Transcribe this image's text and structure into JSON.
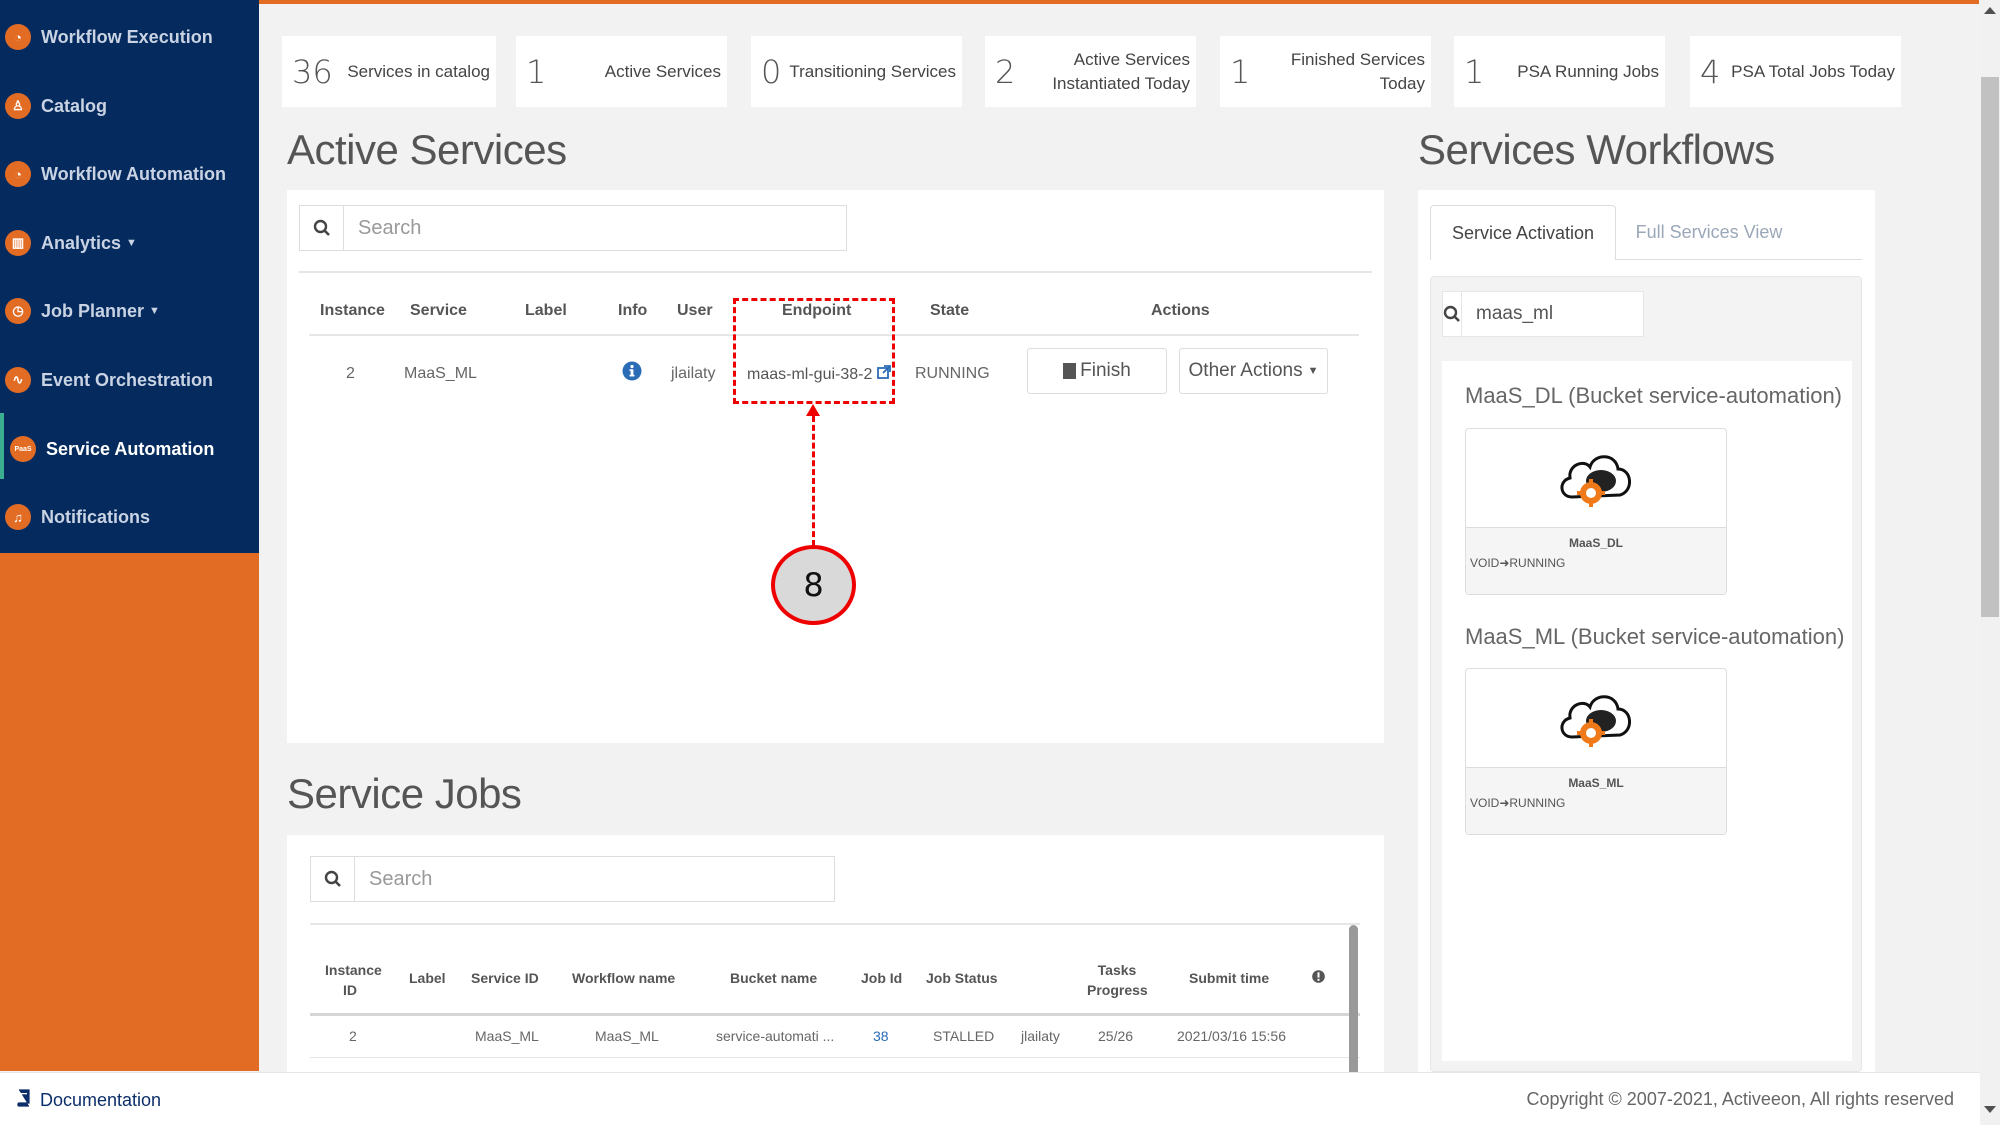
{
  "sidebar": {
    "items": [
      {
        "label": "Workflow Execution",
        "icon": "gauge-icon"
      },
      {
        "label": "Catalog",
        "icon": "catalog-icon"
      },
      {
        "label": "Workflow Automation",
        "icon": "gauge-icon"
      },
      {
        "label": "Analytics",
        "icon": "analytics-icon",
        "has_dropdown": true
      },
      {
        "label": "Job Planner",
        "icon": "clock-icon",
        "has_dropdown": true
      },
      {
        "label": "Event Orchestration",
        "icon": "pulse-icon"
      },
      {
        "label": "Service Automation",
        "icon": "paas-icon",
        "icon_text": "PaaS",
        "active": true
      },
      {
        "label": "Notifications",
        "icon": "bell-icon"
      }
    ],
    "dropdown_glyph": "⌄"
  },
  "stats": [
    {
      "value": "36",
      "label": "Services in catalog"
    },
    {
      "value": "1",
      "label": "Active Services"
    },
    {
      "value": "0",
      "label": "Transitioning Services"
    },
    {
      "value": "2",
      "label": "Active Services Instantiated Today"
    },
    {
      "value": "1",
      "label": "Finished Services Today"
    },
    {
      "value": "1",
      "label": "PSA Running Jobs"
    },
    {
      "value": "4",
      "label": "PSA Total Jobs Today"
    }
  ],
  "active_services": {
    "title": "Active Services",
    "search_placeholder": "Search",
    "columns": [
      "Instance",
      "Service",
      "Label",
      "Info",
      "User",
      "Endpoint",
      "State",
      "Actions"
    ],
    "rows": [
      {
        "instance": "2",
        "service": "MaaS_ML",
        "label": "",
        "info_icon": "info-icon",
        "user": "jlailaty",
        "endpoint": "maas-ml-gui-38-2",
        "state": "RUNNING"
      }
    ],
    "finish_label": "Finish",
    "other_actions_label": "Other Actions"
  },
  "annotation": {
    "number": "8",
    "color": "#e00000"
  },
  "service_jobs": {
    "title": "Service Jobs",
    "search_placeholder": "Search",
    "columns": [
      "Instance ID",
      "Label",
      "Service ID",
      "Workflow name",
      "Bucket name",
      "Job Id",
      "Job Status",
      "",
      "Tasks Progress",
      "Submit time",
      "!"
    ],
    "rows": [
      {
        "instance_id": "2",
        "label": "",
        "service_id": "MaaS_ML",
        "workflow_name": "MaaS_ML",
        "bucket_name": "service-automati ...",
        "job_id": "38",
        "job_status": "STALLED",
        "user": "jlailaty",
        "tasks_progress": "25/26",
        "submit_time": "2021/03/16 15:56"
      }
    ]
  },
  "services_workflows": {
    "title": "Services Workflows",
    "tabs": [
      {
        "label": "Service Activation",
        "active": true
      },
      {
        "label": "Full Services View",
        "active": false
      }
    ],
    "search_value": "maas_ml",
    "groups": [
      {
        "title": "MaaS_DL (Bucket service-automation)",
        "card_name": "MaaS_DL",
        "transition": "VOID➜RUNNING"
      },
      {
        "title": "MaaS_ML (Bucket service-automation)",
        "card_name": "MaaS_ML",
        "transition": "VOID➜RUNNING"
      }
    ]
  },
  "footer": {
    "documentation_label": "Documentation",
    "copyright": "Copyright © 2007-2021, Activeeon, All rights reserved"
  },
  "colors": {
    "sidebar_bg": "#042a5e",
    "brand_orange": "#e36c24",
    "active_indicator": "#3aae8e",
    "link_blue": "#2a6cb5"
  }
}
